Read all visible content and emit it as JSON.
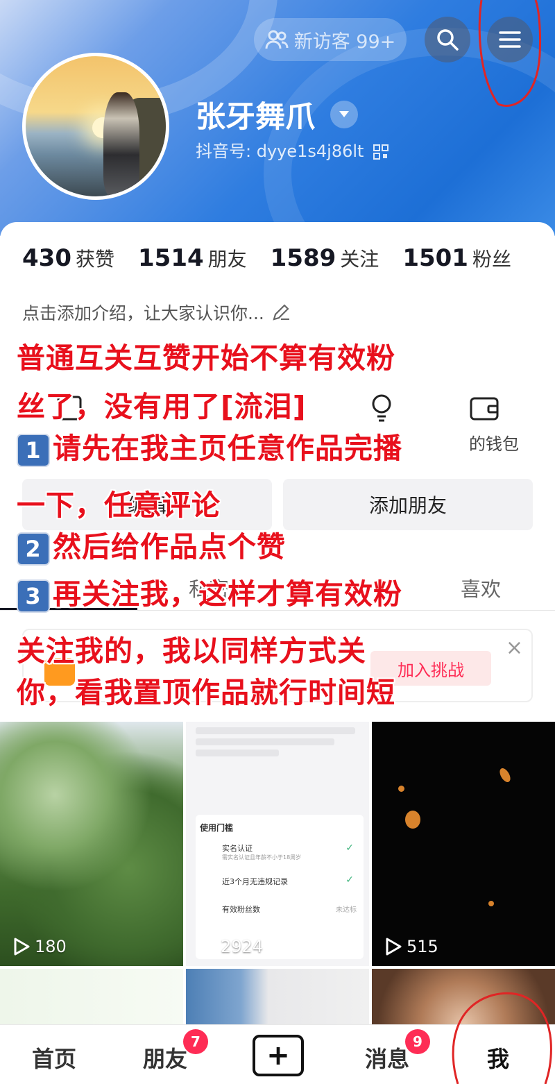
{
  "header": {
    "visitor_label": "新访客 99+",
    "username": "张牙舞爪",
    "douyin_id": "抖音号: dyye1s4j86lt"
  },
  "stats": [
    {
      "value": "430",
      "label": "获赞"
    },
    {
      "value": "1514",
      "label": "朋友"
    },
    {
      "value": "1589",
      "label": "关注"
    },
    {
      "value": "1501",
      "label": "粉丝"
    }
  ],
  "bio_placeholder": "点击添加介绍，让大家认识你...",
  "services": {
    "wallet_label": "的钱包"
  },
  "buttons": {
    "edit": "编辑",
    "add_friend": "添加朋友"
  },
  "tabs": {
    "private": "私密",
    "likes": "喜欢"
  },
  "challenge": {
    "join_label": "加入挑战",
    "close": "×"
  },
  "overlay_text": [
    "普通互关互赞开始不算有效粉",
    "丝了，没有用了[流泪]",
    "请先在我主页任意作品完播",
    "一下，任意评论",
    "然后给作品点个赞",
    "再关注我，这样才算有效粉",
    "关注我的，我以同样方式关",
    "你，看我置顶作品就行时间短"
  ],
  "overlay_numbers": [
    "1",
    "2",
    "3"
  ],
  "videos": [
    {
      "plays": "180"
    },
    {
      "plays": "2924"
    },
    {
      "plays": "515"
    }
  ],
  "doc_preview": {
    "heading": "使用门槛",
    "row1": "实名认证",
    "row1_sub": "需实名认证且年龄不小于18周岁",
    "row2": "近3个月无违规记录",
    "row3": "有效粉丝数",
    "row3_status": "未达标"
  },
  "bottom_nav": {
    "home": "首页",
    "friends": "朋友",
    "friends_badge": "7",
    "create": "+",
    "messages": "消息",
    "messages_badge": "9",
    "me": "我"
  },
  "colors": {
    "accent": "#fe2c55",
    "overlay_red": "#e8101c",
    "header_blue": "#2f7de0"
  }
}
